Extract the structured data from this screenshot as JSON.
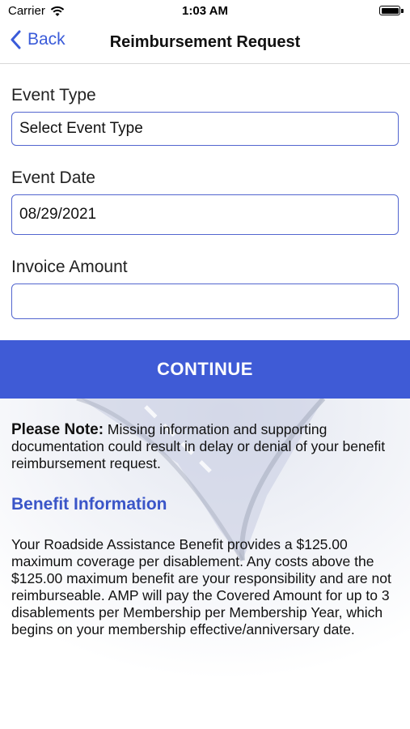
{
  "status_bar": {
    "carrier": "Carrier",
    "time": "1:03 AM",
    "icons": [
      "wifi-icon",
      "battery-icon"
    ]
  },
  "nav": {
    "back_label": "Back",
    "title": "Reimbursement Request",
    "accent_color": "#3a5bd9"
  },
  "form": {
    "event_type": {
      "label": "Event Type",
      "value": "Select Event Type"
    },
    "event_date": {
      "label": "Event Date",
      "value": "08/29/2021"
    },
    "invoice_amount": {
      "label": "Invoice Amount",
      "value": ""
    }
  },
  "continue_label": "CONTINUE",
  "continue_color": "#3f5bd6",
  "note": {
    "prefix": "Please Note:",
    "text": " Missing information and supporting documentation could result in delay or denial of your benefit reimbursement request."
  },
  "benefit": {
    "heading": "Benefit Information",
    "text": "Your Roadside Assistance Benefit provides a $125.00 maximum coverage per disablement. Any costs above the $125.00 maximum benefit are your responsibility and are not reimburseable. AMP will pay the Covered Amount for up to 3 disablements per Membership per Membership Year, which begins on your membership effective/anniversary date."
  }
}
